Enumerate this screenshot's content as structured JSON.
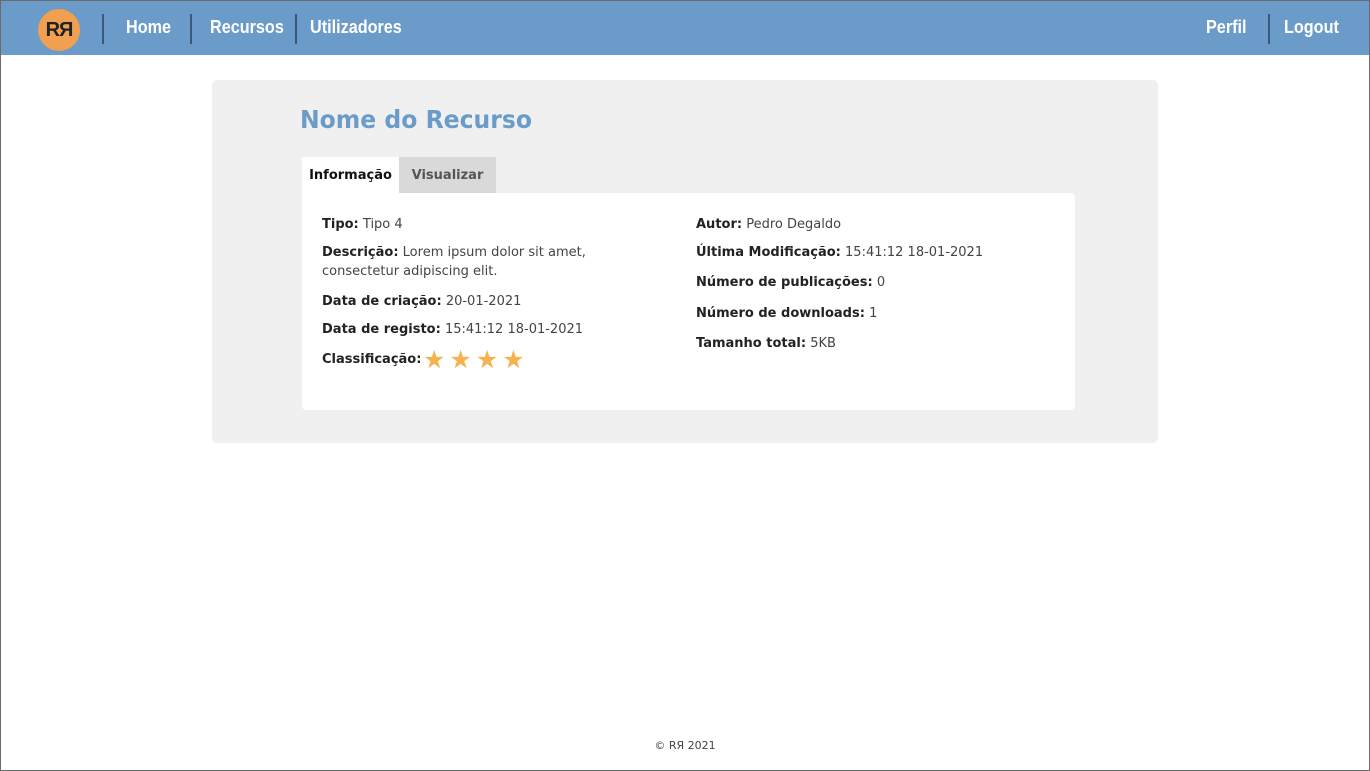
{
  "header": {
    "logo_text": "RЯ",
    "nav": {
      "home": "Home",
      "resources": "Recursos",
      "users": "Utilizadores"
    },
    "right": {
      "profile": "Perfil",
      "logout": "Logout"
    }
  },
  "resource": {
    "title": "Nome do Recurso",
    "tabs": {
      "info": "Informação",
      "view": "Visualizar"
    },
    "left": {
      "type_label": "Tipo:",
      "type_value": "Tipo 4",
      "desc_label": "Descrição:",
      "desc_value": "Lorem ipsum dolor sit amet, consectetur adipiscing elit.",
      "created_label": "Data de criação:",
      "created_value": "20-01-2021",
      "registered_label": "Data de registo:",
      "registered_value": "15:41:12 18-01-2021",
      "rating_label": "Classificação:"
    },
    "right": {
      "author_label": "Autor:",
      "author_value": "Pedro Degaldo",
      "modified_label": "Última Modificação:",
      "modified_value": "15:41:12 18-01-2021",
      "publications_label": "Número de publicações:",
      "publications_value": "0",
      "downloads_label": "Número de downloads:",
      "downloads_value": "1",
      "size_label": "Tamanho total:",
      "size_value": "5KB"
    },
    "rating": {
      "stars": 4,
      "icon": "star-icon",
      "color": "#f5b350"
    }
  },
  "footer": {
    "text": "© RЯ 2021"
  },
  "colors": {
    "accent": "#6b9bc9",
    "logo": "#f0a050",
    "panel": "#f0f0f0"
  }
}
